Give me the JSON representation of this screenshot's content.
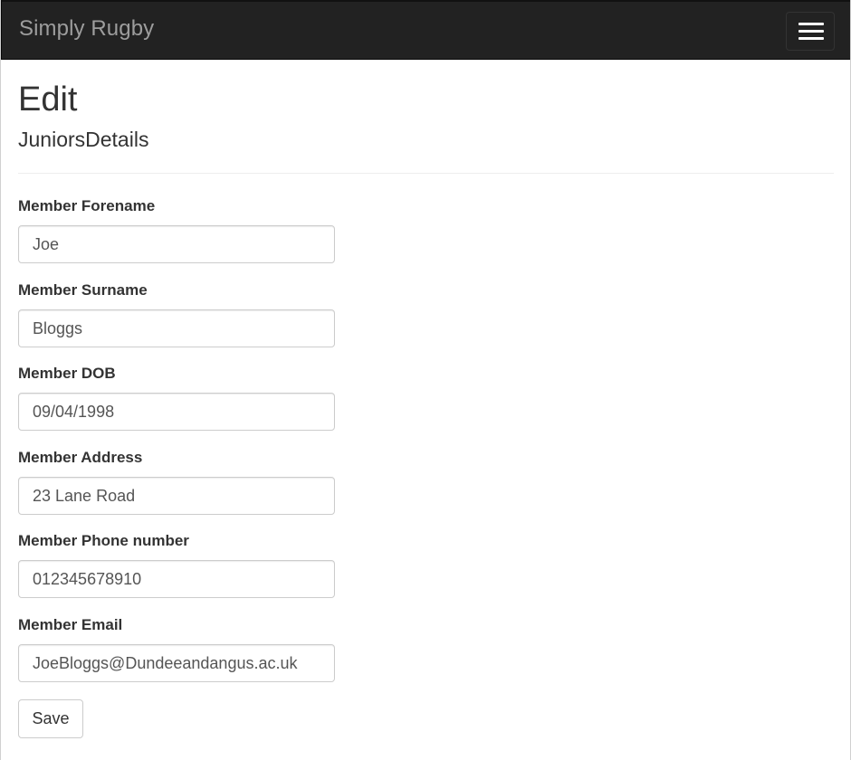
{
  "navbar": {
    "brand": "Simply Rugby",
    "toggle_icon": "hamburger-menu-icon"
  },
  "page": {
    "title": "Edit",
    "subtitle": "JuniorsDetails"
  },
  "form": {
    "fields": [
      {
        "label": "Member Forename",
        "value": "Joe"
      },
      {
        "label": "Member Surname",
        "value": "Bloggs"
      },
      {
        "label": "Member DOB",
        "value": "09/04/1998"
      },
      {
        "label": "Member Address",
        "value": "23 Lane Road"
      },
      {
        "label": "Member Phone number",
        "value": "012345678910"
      },
      {
        "label": "Member Email",
        "value": "JoeBloggs@Dundeeandangus.ac.uk"
      }
    ],
    "save_label": "Save"
  },
  "colors": {
    "navbar_bg": "#222222",
    "brand_text": "#9d9d9d",
    "input_border": "#cccccc"
  }
}
